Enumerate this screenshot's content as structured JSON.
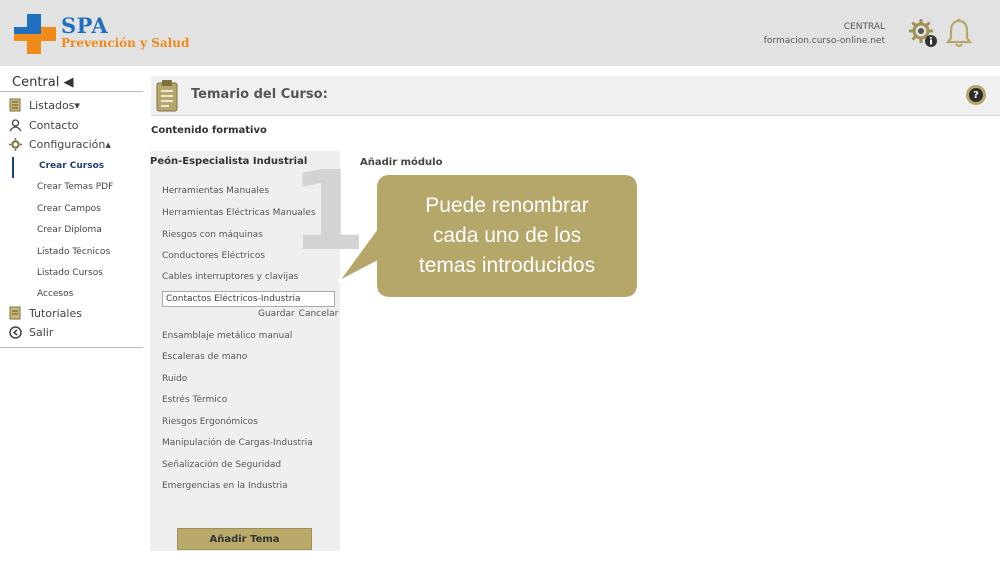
{
  "header": {
    "brand_name": "SPA",
    "brand_sub": "Prevención y Salud",
    "org_label": "CENTRAL",
    "domain": "formacion.curso-online.net",
    "icons": [
      "settings-info-icon",
      "bell-icon"
    ],
    "colors": {
      "brand_blue": "#1e6fc0",
      "brand_orange": "#f08a1a"
    }
  },
  "sidebar": {
    "title": "Central ◀",
    "items": [
      {
        "label": "Listados▾",
        "icon": "list-icon"
      },
      {
        "label": "Contacto",
        "icon": "contact-icon"
      },
      {
        "label": "Configuración▴",
        "icon": "gear-icon"
      }
    ],
    "sub_items": [
      {
        "label": "Crear Cursos",
        "active": true
      },
      {
        "label": "Crear Temas PDF"
      },
      {
        "label": "Crear Campos"
      },
      {
        "label": "Crear Diploma"
      },
      {
        "label": "Listado Técnicos"
      },
      {
        "label": "Listado Cursos"
      },
      {
        "label": "Accesos"
      }
    ],
    "bottom_items": [
      {
        "label": "Tutoriales",
        "icon": "book-icon"
      },
      {
        "label": "Salir",
        "icon": "logout-icon"
      }
    ]
  },
  "main": {
    "title": "Temario del Curso:",
    "section_title": "Contenido formativo",
    "module": {
      "title": "Peón-Especialista Industrial",
      "number": "1",
      "topics": [
        "Herramientas Manuales",
        "Herramientas Eléctricas Manuales",
        "Riesgos con máquinas",
        "Conductores Eléctricos",
        "Cables interruptores y clavijas"
      ],
      "edit_value": "Contactos Eléctricos-Industria",
      "save_label": "Guardar",
      "cancel_label": "Cancelar",
      "topics_after": [
        "Ensamblaje metálico manual",
        "Escaleras de mano",
        "Ruido",
        "Estrés Térmico",
        "Riesgos Ergonómicos",
        "Manipulación de Cargas-Industria",
        "Señalización de Seguridad",
        "Emergencias en la Industria"
      ],
      "add_topic_label": "Añadir Tema"
    },
    "add_module_label": "Añadir módulo"
  },
  "tooltip": {
    "lines": [
      "Puede renombrar",
      "cada uno de los",
      "temas introducidos"
    ],
    "color": "#b5a66a"
  }
}
